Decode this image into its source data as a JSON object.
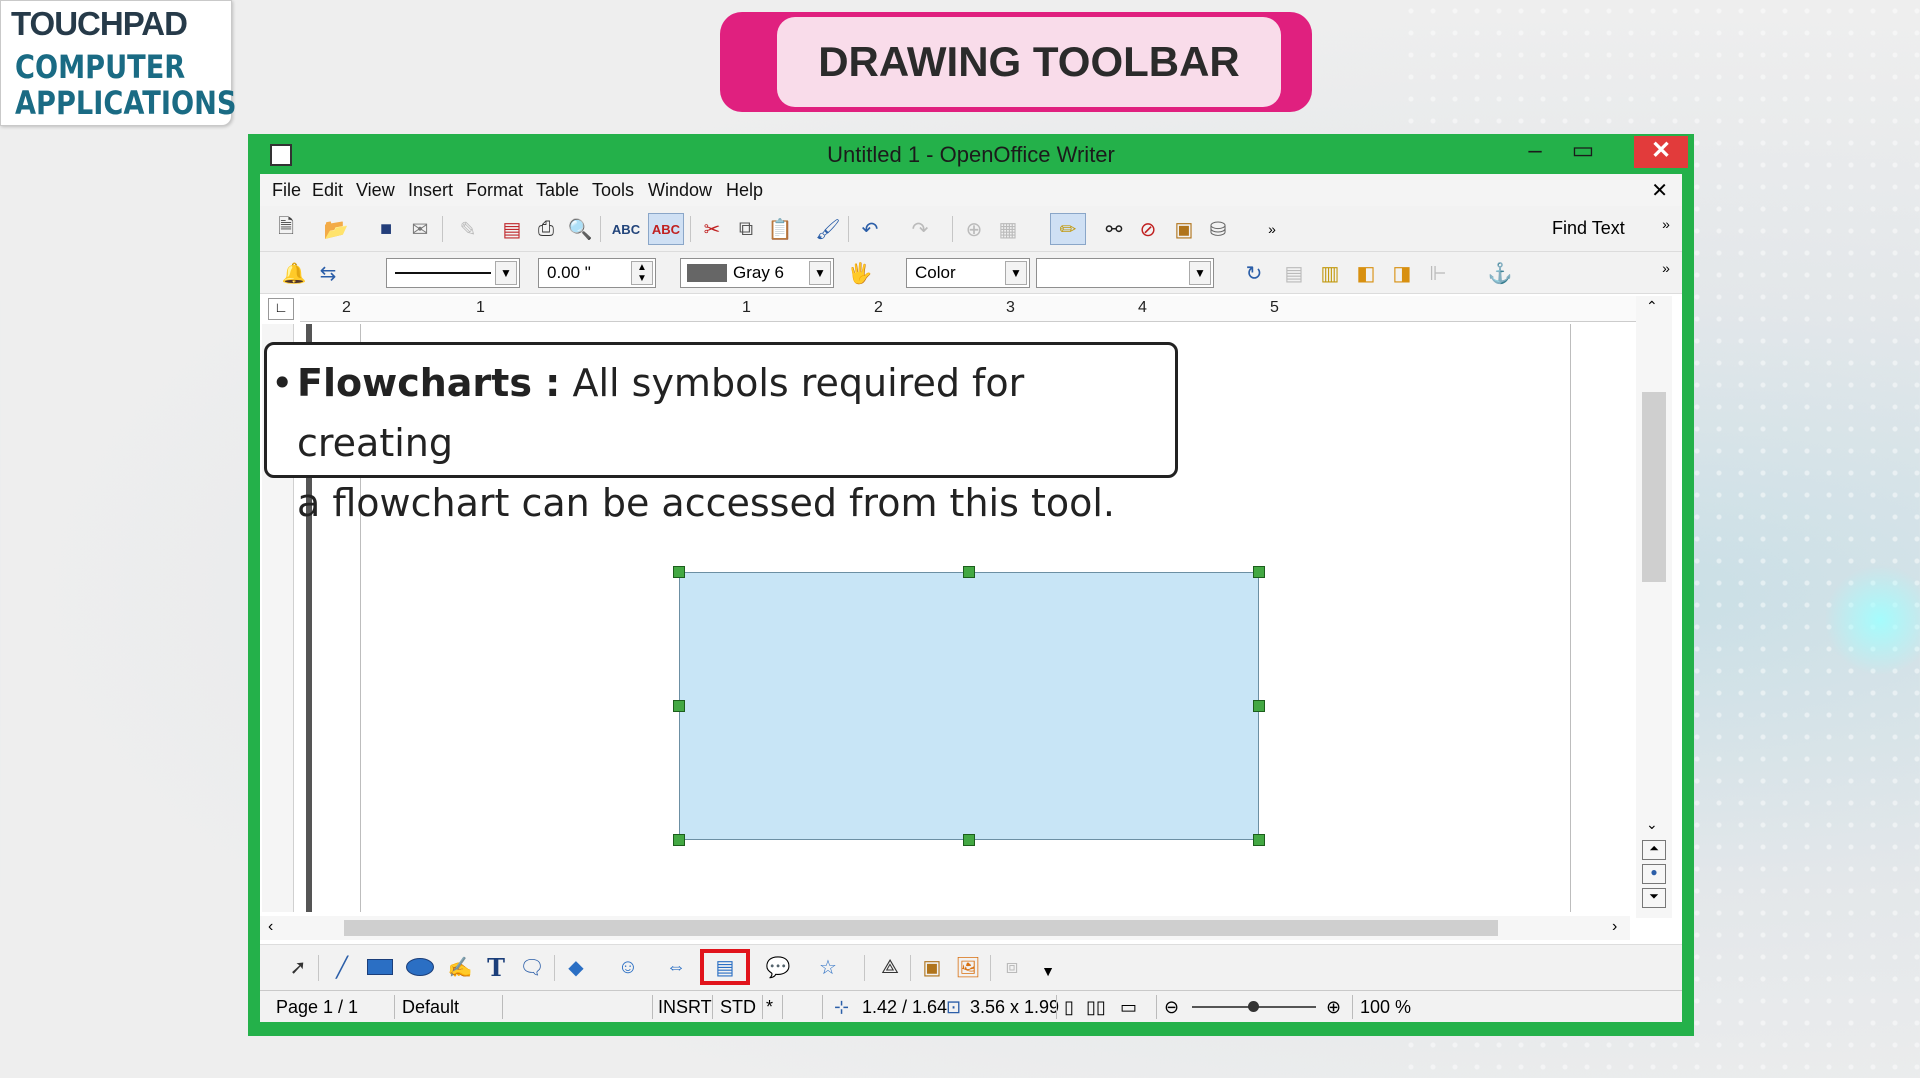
{
  "logo": {
    "brand": "TOUCHPAD",
    "line1": "COMPUTER",
    "line2": "APPLICATIONS"
  },
  "banner": {
    "title": "DRAWING TOOLBAR"
  },
  "window": {
    "title": "Untitled 1 - OpenOffice Writer",
    "min": "–",
    "max": "▭",
    "close": "✕"
  },
  "menu": {
    "items": [
      "File",
      "Edit",
      "View",
      "Insert",
      "Format",
      "Table",
      "Tools",
      "Window",
      "Help"
    ],
    "close_doc": "✕"
  },
  "toolbar1": {
    "find_text": "Find Text"
  },
  "toolbar2": {
    "line_width": "0.00 \"",
    "line_color": "Gray 6",
    "area_style": "Color",
    "area_fill": ""
  },
  "ruler": {
    "labels": [
      "2",
      "1",
      "1",
      "2",
      "3",
      "4",
      "5"
    ]
  },
  "callout": {
    "bullet": "•",
    "term": "Flowcharts :",
    "text1": " All symbols required for creating",
    "text2": "a flowchart can be accessed from this tool."
  },
  "statusbar": {
    "page": "Page 1 / 1",
    "style": "Default",
    "mode": "INSRT",
    "selection": "STD",
    "modified": "*",
    "position": "1.42 / 1.64",
    "size": "3.56 x 1.99",
    "zoom": "100 %"
  },
  "colors": {
    "window_frame": "#24b14a",
    "banner": "#e0207f",
    "banner_inner": "#f9dcea",
    "shape_fill": "#c8e5f6",
    "highlight": "#e1141c"
  }
}
